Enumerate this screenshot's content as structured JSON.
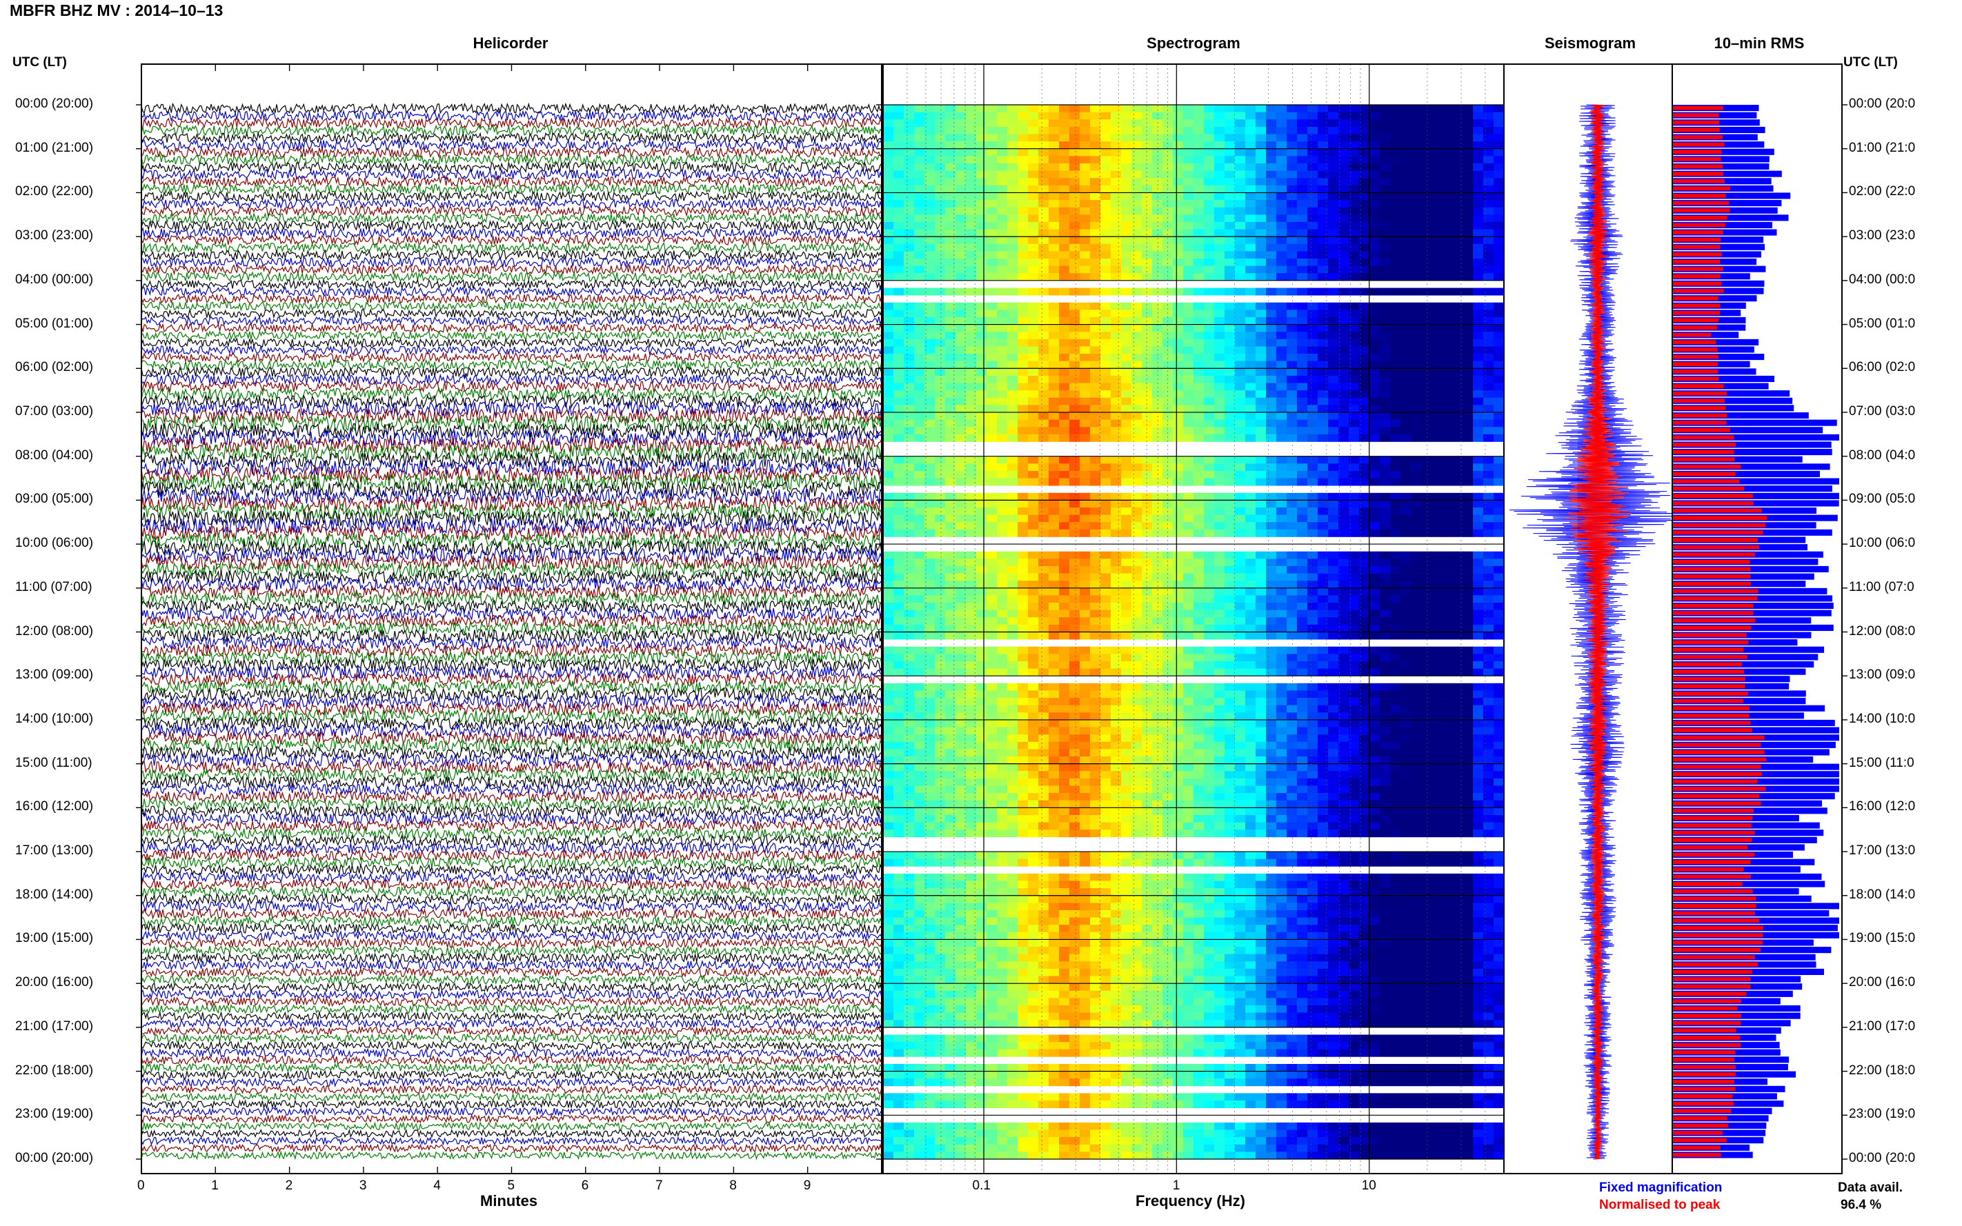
{
  "title": "MBFR BHZ MV : 2014–10–13",
  "chart_data": [
    {
      "panel": "helicorder",
      "type": "line",
      "title": "Helicorder",
      "xlabel": "Minutes",
      "ylabel": "UTC (LT)",
      "xticks": [
        "0",
        "1",
        "2",
        "3",
        "4",
        "5",
        "6",
        "7",
        "8",
        "9"
      ],
      "xlim": [
        0,
        10
      ],
      "trace_colors": [
        "#000000",
        "#0000cc",
        "#8b0000",
        "#008000"
      ],
      "rows": 144,
      "activity_by_hour": [
        0.5,
        0.55,
        0.5,
        0.5,
        0.45,
        0.4,
        0.55,
        1.0,
        1.0,
        1.0,
        0.9,
        0.7,
        0.75,
        0.75,
        0.8,
        0.65,
        0.6,
        0.55,
        0.5,
        0.45,
        0.4,
        0.4,
        0.35,
        0.3
      ]
    },
    {
      "panel": "spectrogram",
      "type": "heatmap",
      "title": "Spectrogram",
      "xlabel": "Frequency (Hz)",
      "xscale": "log",
      "xticks": [
        "0.1",
        "1",
        "10"
      ],
      "xlim": [
        0.03,
        50
      ],
      "peak_band_hz": [
        0.2,
        0.4
      ]
    },
    {
      "panel": "seismogram",
      "type": "line",
      "title": "Seismogram",
      "series": [
        {
          "name": "Fixed magnification",
          "color": "#0000ff"
        },
        {
          "name": "Normalised to peak",
          "color": "#ff0000"
        }
      ],
      "amplitude_by_hour": [
        0.2,
        0.2,
        0.2,
        0.3,
        0.2,
        0.2,
        0.2,
        0.4,
        0.7,
        1.0,
        0.4,
        0.3,
        0.3,
        0.25,
        0.3,
        0.2,
        0.2,
        0.2,
        0.2,
        0.15,
        0.15,
        0.15,
        0.12,
        0.12
      ]
    },
    {
      "panel": "rms",
      "type": "bar",
      "title": "10–min RMS",
      "orientation": "horizontal",
      "series": [
        {
          "name": "Fixed magnification",
          "color": "#0000ff",
          "values": [
            0.55,
            0.6,
            0.7,
            0.6,
            0.5,
            0.45,
            0.6,
            0.95,
            0.9,
            1.0,
            0.85,
            0.9,
            0.85,
            0.8,
            1.0,
            0.95,
            0.85,
            0.85,
            1.0,
            0.85,
            0.7,
            0.7,
            0.6,
            0.5
          ]
        },
        {
          "name": "Normalised to peak",
          "color": "#ff0000",
          "values": [
            0.3,
            0.3,
            0.35,
            0.3,
            0.3,
            0.25,
            0.3,
            0.35,
            0.4,
            0.55,
            0.5,
            0.5,
            0.45,
            0.45,
            0.55,
            0.55,
            0.5,
            0.45,
            0.55,
            0.5,
            0.4,
            0.4,
            0.35,
            0.3
          ]
        }
      ]
    }
  ],
  "time_axis": {
    "header": "UTC (LT)",
    "labels": [
      "00:00 (20:00)",
      "01:00 (21:00)",
      "02:00 (22:00)",
      "03:00 (23:00)",
      "04:00 (00:00)",
      "05:00 (01:00)",
      "06:00 (02:00)",
      "07:00 (03:00)",
      "08:00 (04:00)",
      "09:00 (05:00)",
      "10:00 (06:00)",
      "11:00 (07:00)",
      "12:00 (08:00)",
      "13:00 (09:00)",
      "14:00 (10:00)",
      "15:00 (11:00)",
      "16:00 (12:00)",
      "17:00 (13:00)",
      "18:00 (14:00)",
      "19:00 (15:00)",
      "20:00 (16:00)",
      "21:00 (17:00)",
      "22:00 (18:00)",
      "23:00 (19:00)",
      "00:00 (20:00)"
    ],
    "right_labels": [
      "00:00 (20:0",
      "01:00 (21:0",
      "02:00 (22:0",
      "03:00 (23:0",
      "04:00 (00:0",
      "05:00 (01:0",
      "06:00 (02:0",
      "07:00 (03:0",
      "08:00 (04:0",
      "09:00 (05:0",
      "10:00 (06:0",
      "11:00 (07:0",
      "12:00 (08:0",
      "13:00 (09:0",
      "14:00 (10:0",
      "15:00 (11:0",
      "16:00 (12:0",
      "17:00 (13:0",
      "18:00 (14:0",
      "19:00 (15:0",
      "20:00 (16:0",
      "21:00 (17:0",
      "22:00 (18:0",
      "23:00 (19:0",
      "00:00 (20:0"
    ]
  },
  "legend": {
    "fixed": "Fixed magnification",
    "normalised": "Normalised to peak",
    "fixed_color": "#0000ff",
    "normalised_color": "#ff0000"
  },
  "data_avail": {
    "label": "Data avail.",
    "value": "96.4 %"
  }
}
